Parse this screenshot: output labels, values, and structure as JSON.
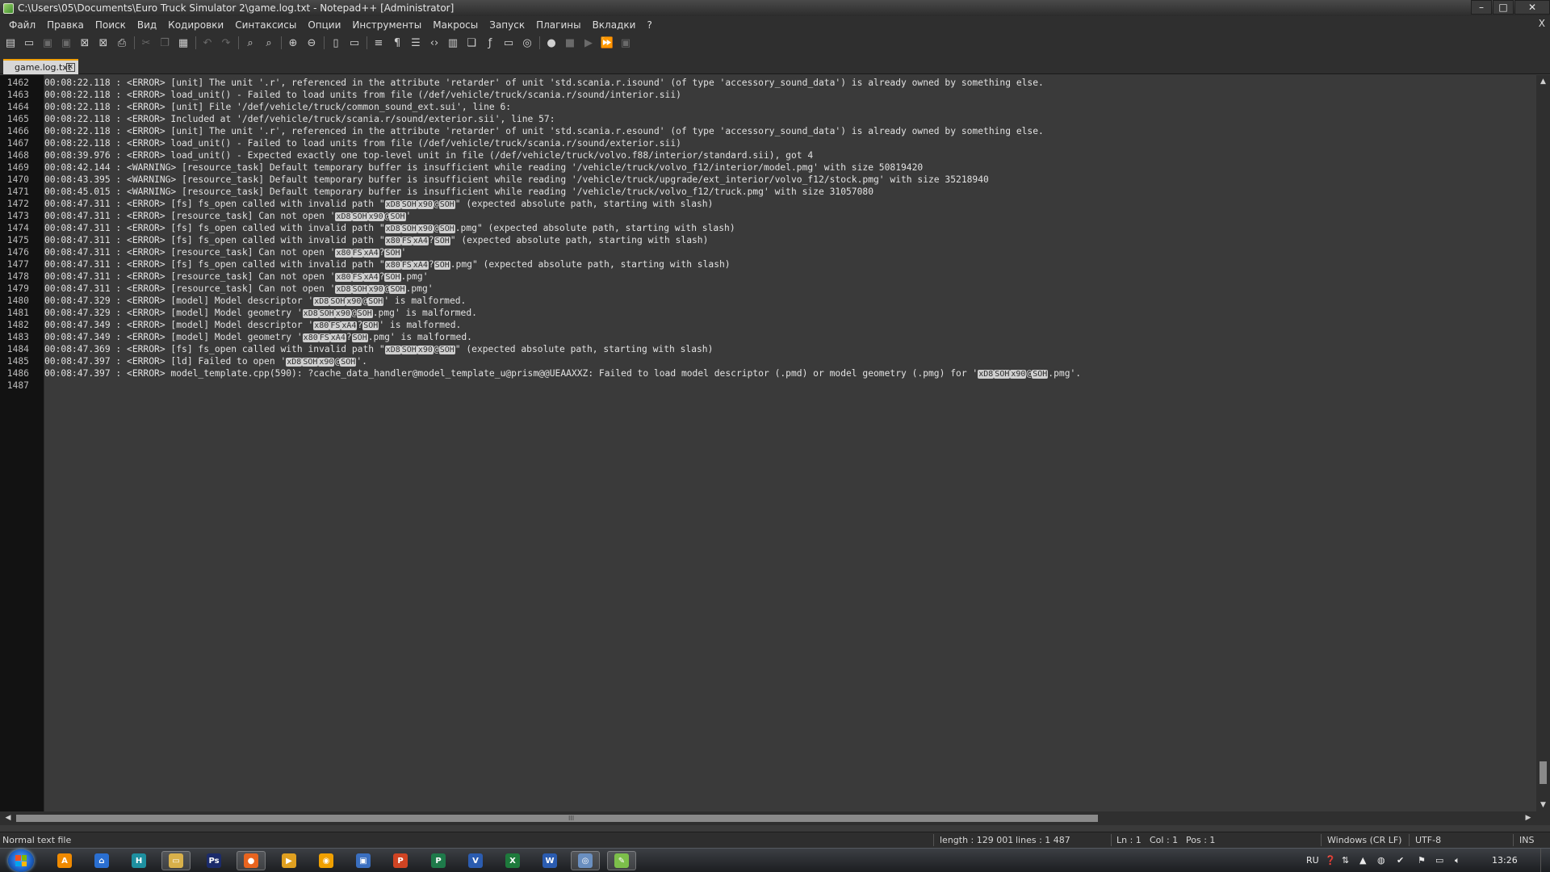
{
  "window": {
    "title": "C:\\Users\\05\\Documents\\Euro Truck Simulator 2\\game.log.txt - Notepad++ [Administrator]",
    "minimize": "–",
    "maximize": "□",
    "close": "✕"
  },
  "menu": {
    "items": [
      "Файл",
      "Правка",
      "Поиск",
      "Вид",
      "Кодировки",
      "Синтаксисы",
      "Опции",
      "Инструменты",
      "Макросы",
      "Запуск",
      "Плагины",
      "Вкладки",
      "?"
    ],
    "close_label": "X"
  },
  "toolbar": {
    "buttons": [
      {
        "name": "new-file-icon",
        "glyph": "▤"
      },
      {
        "name": "open-file-icon",
        "glyph": "▭"
      },
      {
        "name": "save-icon",
        "glyph": "▣",
        "dim": true
      },
      {
        "name": "save-all-icon",
        "glyph": "▣",
        "dim": true
      },
      {
        "name": "close-file-icon",
        "glyph": "⊠"
      },
      {
        "name": "close-all-icon",
        "glyph": "⊠"
      },
      {
        "name": "print-icon",
        "glyph": "⎙"
      },
      {
        "sep": true
      },
      {
        "name": "cut-icon",
        "glyph": "✂",
        "dim": true
      },
      {
        "name": "copy-icon",
        "glyph": "❐",
        "dim": true
      },
      {
        "name": "paste-icon",
        "glyph": "▦"
      },
      {
        "sep": true
      },
      {
        "name": "undo-icon",
        "glyph": "↶",
        "dim": true
      },
      {
        "name": "redo-icon",
        "glyph": "↷",
        "dim": true
      },
      {
        "sep": true
      },
      {
        "name": "find-icon",
        "glyph": "⌕"
      },
      {
        "name": "replace-icon",
        "glyph": "⌕"
      },
      {
        "sep": true
      },
      {
        "name": "zoom-in-icon",
        "glyph": "⊕"
      },
      {
        "name": "zoom-out-icon",
        "glyph": "⊖"
      },
      {
        "sep": true
      },
      {
        "name": "sync-vertical-icon",
        "glyph": "▯"
      },
      {
        "name": "sync-horizontal-icon",
        "glyph": "▭"
      },
      {
        "sep": true
      },
      {
        "name": "word-wrap-icon",
        "glyph": "≡"
      },
      {
        "name": "show-all-chars-icon",
        "glyph": "¶"
      },
      {
        "name": "indent-guide-icon",
        "glyph": "☰"
      },
      {
        "name": "xml-tag-icon",
        "glyph": "‹›"
      },
      {
        "name": "document-map-icon",
        "glyph": "▥"
      },
      {
        "name": "function-list-icon",
        "glyph": "❏"
      },
      {
        "name": "function-icon",
        "glyph": "ƒ"
      },
      {
        "name": "monitor-icon",
        "glyph": "▭"
      },
      {
        "name": "folder-workspace-icon",
        "glyph": "◎"
      },
      {
        "sep": true
      },
      {
        "name": "record-macro-icon",
        "glyph": "●"
      },
      {
        "name": "stop-macro-icon",
        "glyph": "■",
        "dim": true
      },
      {
        "name": "play-macro-icon",
        "glyph": "▶",
        "dim": true
      },
      {
        "name": "run-macro-multiple-icon",
        "glyph": "⏩"
      },
      {
        "name": "save-macro-icon",
        "glyph": "▣",
        "dim": true
      }
    ]
  },
  "tab": {
    "label": "game.log.txt",
    "close": "x"
  },
  "editor": {
    "lines": [
      {
        "n": "1462",
        "parts": [
          {
            "t": "00:08:22.118 : <ERROR> [unit] The unit '.r', referenced in the attribute 'retarder' of unit 'std.scania.r.isound' (of type 'accessory_sound_data') is already owned by something else."
          }
        ]
      },
      {
        "n": "1463",
        "parts": [
          {
            "t": "00:08:22.118 : <ERROR> load_unit() - Failed to load units from file (/def/vehicle/truck/scania.r/sound/interior.sii)"
          }
        ]
      },
      {
        "n": "1464",
        "parts": [
          {
            "t": "00:08:22.118 : <ERROR> [unit] File '/def/vehicle/truck/common_sound_ext.sui', line 6:"
          }
        ]
      },
      {
        "n": "1465",
        "parts": [
          {
            "t": "00:08:22.118 : <ERROR> Included at '/def/vehicle/truck/scania.r/sound/exterior.sii', line 57:"
          }
        ]
      },
      {
        "n": "1466",
        "parts": [
          {
            "t": "00:08:22.118 : <ERROR> [unit] The unit '.r', referenced in the attribute 'retarder' of unit 'std.scania.r.esound' (of type 'accessory_sound_data') is already owned by something else."
          }
        ]
      },
      {
        "n": "1467",
        "parts": [
          {
            "t": "00:08:22.118 : <ERROR> load_unit() - Failed to load units from file (/def/vehicle/truck/scania.r/sound/exterior.sii)"
          }
        ]
      },
      {
        "n": "1468",
        "parts": [
          {
            "t": "00:08:39.976 : <ERROR> load_unit() - Expected exactly one top-level unit in file (/def/vehicle/truck/volvo.f88/interior/standard.sii), got 4"
          }
        ]
      },
      {
        "n": "1469",
        "parts": [
          {
            "t": "00:08:42.144 : <WARNING> [resource_task] Default temporary buffer is insufficient while reading '/vehicle/truck/volvo_f12/interior/model.pmg' with size 50819420"
          }
        ]
      },
      {
        "n": "1470",
        "parts": [
          {
            "t": "00:08:43.395 : <WARNING> [resource_task] Default temporary buffer is insufficient while reading '/vehicle/truck/upgrade/ext_interior/volvo_f12/stock.pmg' with size 35218940"
          }
        ]
      },
      {
        "n": "1471",
        "parts": [
          {
            "t": "00:08:45.015 : <WARNING> [resource_task] Default temporary buffer is insufficient while reading '/vehicle/truck/volvo_f12/truck.pmg' with size 31057080"
          }
        ]
      },
      {
        "n": "1472",
        "parts": [
          {
            "t": "00:08:47.311 : <ERROR> [fs] fs_open called with invalid path \""
          },
          {
            "c": "xD8"
          },
          {
            "c": "SOH"
          },
          {
            "c": "x90"
          },
          {
            "t": "@"
          },
          {
            "c": "SOH"
          },
          {
            "t": "\" (expected absolute path, starting with slash)"
          }
        ]
      },
      {
        "n": "1473",
        "parts": [
          {
            "t": "00:08:47.311 : <ERROR> [resource_task] Can not open '"
          },
          {
            "c": "xD8"
          },
          {
            "c": "SOH"
          },
          {
            "c": "x90"
          },
          {
            "t": "@"
          },
          {
            "c": "SOH"
          },
          {
            "t": "'"
          }
        ]
      },
      {
        "n": "1474",
        "parts": [
          {
            "t": "00:08:47.311 : <ERROR> [fs] fs_open called with invalid path \""
          },
          {
            "c": "xD8"
          },
          {
            "c": "SOH"
          },
          {
            "c": "x90"
          },
          {
            "t": "@"
          },
          {
            "c": "SOH"
          },
          {
            "t": ".pmg\" (expected absolute path, starting with slash)"
          }
        ]
      },
      {
        "n": "1475",
        "parts": [
          {
            "t": "00:08:47.311 : <ERROR> [fs] fs_open called with invalid path \""
          },
          {
            "c": "x80"
          },
          {
            "c": "FS"
          },
          {
            "c": "xA4"
          },
          {
            "t": "?"
          },
          {
            "c": "SOH"
          },
          {
            "t": "\" (expected absolute path, starting with slash)"
          }
        ]
      },
      {
        "n": "1476",
        "parts": [
          {
            "t": "00:08:47.311 : <ERROR> [resource_task] Can not open '"
          },
          {
            "c": "x80"
          },
          {
            "c": "FS"
          },
          {
            "c": "xA4"
          },
          {
            "t": "?"
          },
          {
            "c": "SOH"
          },
          {
            "t": "'"
          }
        ]
      },
      {
        "n": "1477",
        "parts": [
          {
            "t": "00:08:47.311 : <ERROR> [fs] fs_open called with invalid path \""
          },
          {
            "c": "x80"
          },
          {
            "c": "FS"
          },
          {
            "c": "xA4"
          },
          {
            "t": "?"
          },
          {
            "c": "SOH"
          },
          {
            "t": ".pmg\" (expected absolute path, starting with slash)"
          }
        ]
      },
      {
        "n": "1478",
        "parts": [
          {
            "t": "00:08:47.311 : <ERROR> [resource_task] Can not open '"
          },
          {
            "c": "x80"
          },
          {
            "c": "FS"
          },
          {
            "c": "xA4"
          },
          {
            "t": "?"
          },
          {
            "c": "SOH"
          },
          {
            "t": ".pmg'"
          }
        ]
      },
      {
        "n": "1479",
        "parts": [
          {
            "t": "00:08:47.311 : <ERROR> [resource_task] Can not open '"
          },
          {
            "c": "xD8"
          },
          {
            "c": "SOH"
          },
          {
            "c": "x90"
          },
          {
            "t": "@"
          },
          {
            "c": "SOH"
          },
          {
            "t": ".pmg'"
          }
        ]
      },
      {
        "n": "1480",
        "parts": [
          {
            "t": "00:08:47.329 : <ERROR> [model] Model descriptor '"
          },
          {
            "c": "xD8"
          },
          {
            "c": "SOH"
          },
          {
            "c": "x90"
          },
          {
            "t": "@"
          },
          {
            "c": "SOH"
          },
          {
            "t": "' is malformed."
          }
        ]
      },
      {
        "n": "1481",
        "parts": [
          {
            "t": "00:08:47.329 : <ERROR> [model] Model geometry '"
          },
          {
            "c": "xD8"
          },
          {
            "c": "SOH"
          },
          {
            "c": "x90"
          },
          {
            "t": "@"
          },
          {
            "c": "SOH"
          },
          {
            "t": ".pmg' is malformed."
          }
        ]
      },
      {
        "n": "1482",
        "parts": [
          {
            "t": "00:08:47.349 : <ERROR> [model] Model descriptor '"
          },
          {
            "c": "x80"
          },
          {
            "c": "FS"
          },
          {
            "c": "xA4"
          },
          {
            "t": "?"
          },
          {
            "c": "SOH"
          },
          {
            "t": "' is malformed."
          }
        ]
      },
      {
        "n": "1483",
        "parts": [
          {
            "t": "00:08:47.349 : <ERROR> [model] Model geometry '"
          },
          {
            "c": "x80"
          },
          {
            "c": "FS"
          },
          {
            "c": "xA4"
          },
          {
            "t": "?"
          },
          {
            "c": "SOH"
          },
          {
            "t": ".pmg' is malformed."
          }
        ]
      },
      {
        "n": "1484",
        "parts": [
          {
            "t": "00:08:47.369 : <ERROR> [fs] fs_open called with invalid path \""
          },
          {
            "c": "xD8"
          },
          {
            "c": "SOH"
          },
          {
            "c": "x90"
          },
          {
            "t": "@"
          },
          {
            "c": "SOH"
          },
          {
            "t": "\" (expected absolute path, starting with slash)"
          }
        ]
      },
      {
        "n": "1485",
        "parts": [
          {
            "t": "00:08:47.397 : <ERROR> [ld] Failed to open '"
          },
          {
            "c": "xD8"
          },
          {
            "c": "SOH"
          },
          {
            "c": "x90"
          },
          {
            "t": "@"
          },
          {
            "c": "SOH"
          },
          {
            "t": "'."
          }
        ]
      },
      {
        "n": "1486",
        "parts": [
          {
            "t": "00:08:47.397 : <ERROR> model_template.cpp(590): ?cache_data_handler@model_template_u@prism@@UEAAXXZ: Failed to load model descriptor (.pmd) or model geometry (.pmg) for '"
          },
          {
            "c": "xD8"
          },
          {
            "c": "SOH"
          },
          {
            "c": "x90"
          },
          {
            "t": "@"
          },
          {
            "c": "SOH"
          },
          {
            "t": ".pmg'."
          }
        ]
      },
      {
        "n": "1487",
        "parts": []
      }
    ]
  },
  "scroll": {
    "up": "▲",
    "down": "▼",
    "left": "◀",
    "right": "▶",
    "grip": "III"
  },
  "status": {
    "file_type": "Normal text file",
    "length": "length : 129 001",
    "lines": "lines : 1 487",
    "ln": "Ln : 1",
    "col": "Col : 1",
    "pos": "Pos : 1",
    "eol": "Windows (CR LF)",
    "encoding": "UTF-8",
    "ins": "INS"
  },
  "taskbar": {
    "apps": [
      {
        "name": "avast-icon",
        "glyph": "A",
        "color": "#f08a00"
      },
      {
        "name": "network-icon",
        "glyph": "⌂",
        "color": "#2a6fd1"
      },
      {
        "name": "hwmonitor-icon",
        "glyph": "H",
        "color": "#1e90a0"
      },
      {
        "name": "explorer-icon",
        "glyph": "▭",
        "color": "#d8b04a",
        "active": true
      },
      {
        "name": "photoshop-icon",
        "glyph": "Ps",
        "color": "#1b2b6b"
      },
      {
        "name": "firefox-icon",
        "glyph": "●",
        "color": "#e8641f",
        "active": true
      },
      {
        "name": "media-icon",
        "glyph": "▶",
        "color": "#e0a020"
      },
      {
        "name": "player-icon",
        "glyph": "◉",
        "color": "#f0a000"
      },
      {
        "name": "floppy-icon",
        "glyph": "▣",
        "color": "#3a6fc0"
      },
      {
        "name": "powerpoint-icon",
        "glyph": "P",
        "color": "#d04423"
      },
      {
        "name": "publisher-icon",
        "glyph": "P",
        "color": "#1e7a4a"
      },
      {
        "name": "visio-icon",
        "glyph": "V",
        "color": "#2b5cb0"
      },
      {
        "name": "excel-icon",
        "glyph": "X",
        "color": "#1e7a3c"
      },
      {
        "name": "word-icon",
        "glyph": "W",
        "color": "#2b5cb0"
      },
      {
        "name": "chrome-icon",
        "glyph": "◎",
        "color": "#6a8fc0",
        "active": true
      },
      {
        "name": "notepadpp-icon",
        "glyph": "✎",
        "color": "#7cbf4a",
        "active": true
      }
    ],
    "lang": "RU",
    "clock": "13:26"
  },
  "colors": {
    "editor_bg": "#3a3a3a",
    "gutter_bg": "#121212",
    "tab_accent": "#f0a000"
  }
}
